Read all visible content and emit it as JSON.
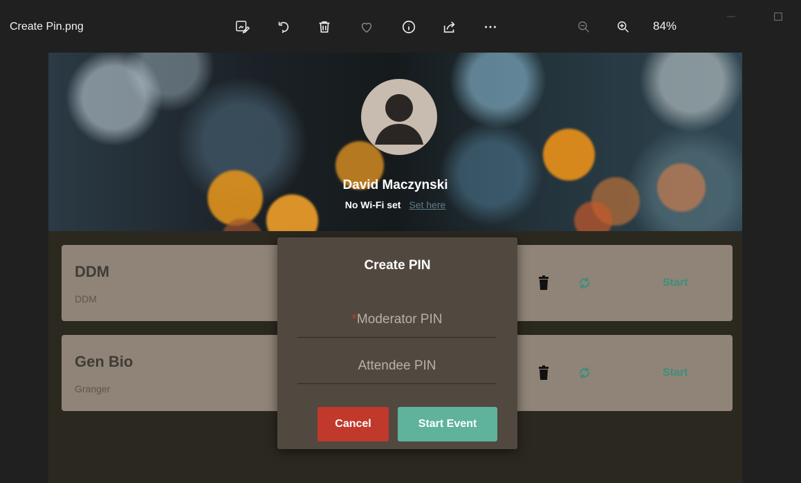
{
  "window": {
    "title": "Create Pin.png",
    "zoom": "84%"
  },
  "toolbar": {
    "icons": [
      "edit-image-icon",
      "rotate-icon",
      "delete-icon",
      "favorite-icon",
      "info-icon",
      "share-icon",
      "more-icon",
      "zoom-out-icon",
      "zoom-in-icon"
    ]
  },
  "profile": {
    "name": "David Maczynski",
    "wifi_status": "No Wi-Fi set",
    "wifi_link": "Set here"
  },
  "events": [
    {
      "title": "DDM",
      "subtitle": "DDM",
      "action": "Start"
    },
    {
      "title": "Gen Bio",
      "subtitle": "Granger",
      "action": "Start"
    }
  ],
  "modal": {
    "title": "Create PIN",
    "required_marker": "*",
    "moderator_placeholder": "Moderator PIN",
    "attendee_placeholder": "Attendee PIN",
    "cancel_label": "Cancel",
    "start_label": "Start Event"
  },
  "colors": {
    "cancel": "#c0392b",
    "start_event": "#5fb39d",
    "start_text": "#3f8e7b",
    "card_bg": "#8f8477",
    "modal_bg": "#51483f"
  }
}
